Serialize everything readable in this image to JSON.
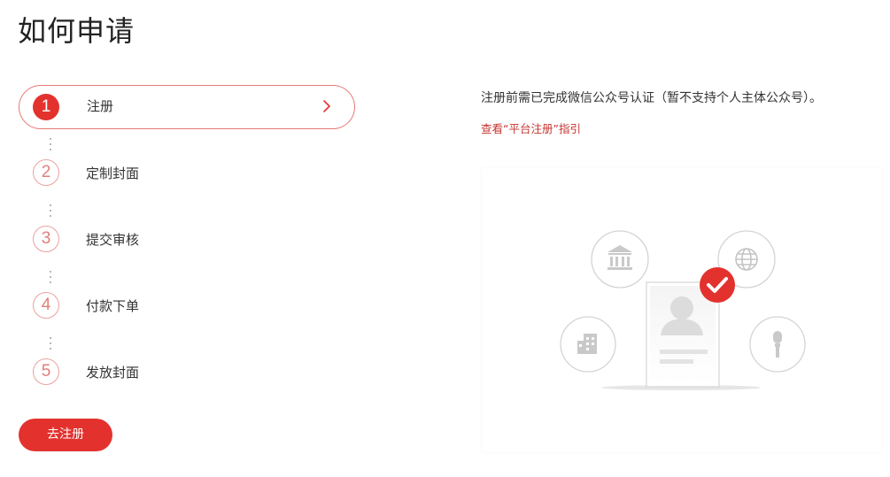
{
  "page": {
    "title": "如何申请"
  },
  "steps": [
    {
      "number": "1",
      "label": "注册",
      "active": true
    },
    {
      "number": "2",
      "label": "定制封面",
      "active": false
    },
    {
      "number": "3",
      "label": "提交审核",
      "active": false
    },
    {
      "number": "4",
      "label": "付款下单",
      "active": false
    },
    {
      "number": "5",
      "label": "发放封面",
      "active": false
    }
  ],
  "cta": {
    "label": "去注册"
  },
  "detail": {
    "description": "注册前需已完成微信公众号认证（暂不支持个人主体公众号）。",
    "guide_link": "查看“平台注册”指引"
  },
  "illustration": {
    "icons": [
      "bank-icon",
      "globe-icon",
      "building-icon",
      "microphone-icon",
      "profile-card-icon",
      "check-badge-icon"
    ]
  },
  "colors": {
    "accent": "#e3322e",
    "accent_light": "#e9a29f",
    "link": "#c6332e"
  }
}
